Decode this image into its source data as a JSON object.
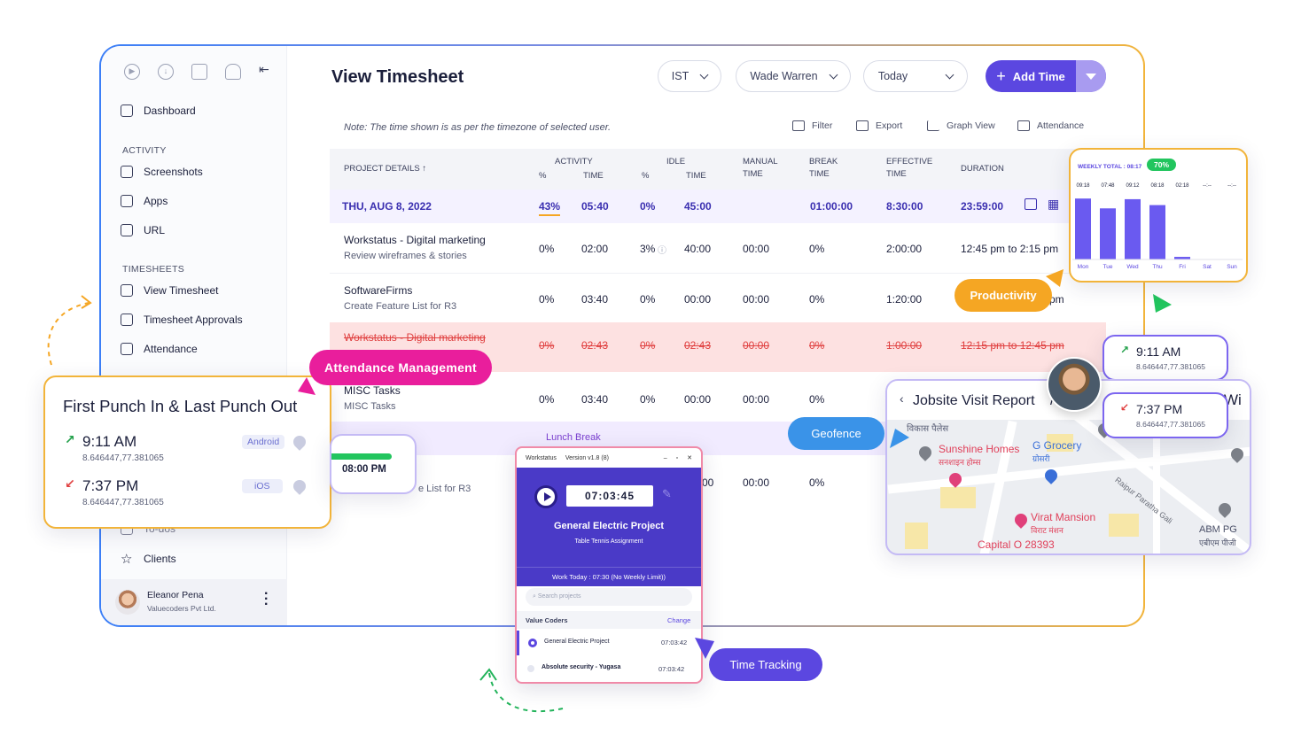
{
  "sidebar": {
    "dashboard": "Dashboard",
    "activity_heading": "ACTIVITY",
    "activity_items": [
      "Screenshots",
      "Apps",
      "URL"
    ],
    "timesheets_heading": "TIMESHEETS",
    "timesheet_items": [
      "View Timesheet",
      "Timesheet Approvals",
      "Attendance"
    ],
    "partial_item": "To-dos",
    "clients": "Clients",
    "user_name": "Eleanor Pena",
    "user_company": "Valuecoders Pvt Ltd."
  },
  "header": {
    "title": "View Timesheet",
    "timezone": "IST",
    "user_select": "Wade Warren",
    "date_select": "Today",
    "add_time": "Add Time"
  },
  "toolbar": {
    "note": "Note: The time shown is as per the timezone of selected user.",
    "filter": "Filter",
    "export": "Export",
    "graph_view": "Graph View",
    "attendance": "Attendance"
  },
  "table": {
    "headers": {
      "project": "PROJECT DETAILS ↑",
      "activity": "ACTIVITY",
      "activity_pct": "%",
      "activity_time": "TIME",
      "idle": "IDLE",
      "idle_pct": "%",
      "idle_time": "TIME",
      "manual": "MANUAL",
      "manual2": "TIME",
      "break": "BREAK",
      "break2": "TIME",
      "effective": "EFFECTIVE",
      "effective2": "TIME",
      "duration": "DURATION"
    },
    "date_row": {
      "date": "THU, AUG 8, 2022",
      "activity_pct": "43%",
      "activity_time": "05:40",
      "idle_pct": "0%",
      "idle_time": "45:00",
      "break_time": "01:00:00",
      "effective": "8:30:00",
      "duration": "23:59:00"
    },
    "rows": [
      {
        "project": "Workstatus - Digital marketing",
        "task": "Review wireframes & stories",
        "a_pct": "0%",
        "a_time": "02:00",
        "i_pct": "3%",
        "i_time": "40:00",
        "manual": "00:00",
        "brk": "0%",
        "effective": "2:00:00",
        "duration": "12:45 pm to 2:15 pm"
      },
      {
        "project": "SoftwareFirms",
        "task": "Create Feature List for R3",
        "a_pct": "0%",
        "a_time": "03:40",
        "i_pct": "0%",
        "i_time": "00:00",
        "manual": "00:00",
        "brk": "0%",
        "effective": "1:20:00",
        "duration": "pm"
      },
      {
        "project": "Workstatus - Digital marketing",
        "task": "",
        "a_pct": "0%",
        "a_time": "02:43",
        "i_pct": "0%",
        "i_time": "02:43",
        "manual": "00:00",
        "brk": "0%",
        "effective": "1:00:00",
        "duration": "12:15 pm to 12:45 pm"
      },
      {
        "project": "MISC Tasks",
        "task": "MISC Tasks",
        "a_pct": "0%",
        "a_time": "03:40",
        "i_pct": "0%",
        "i_time": "00:00",
        "manual": "00:00",
        "brk": "0%",
        "effective": "",
        "duration": ""
      }
    ],
    "lunch": "Lunch Break",
    "last_row": {
      "task": "e List for R3",
      "i_time": "00",
      "manual": "00:00",
      "brk": "0%"
    }
  },
  "tags": {
    "attendance": "Attendance Management",
    "productivity": "Productivity",
    "geofence": "Geofence",
    "time_tracking": "Time Tracking"
  },
  "punch_card": {
    "title": "First Punch In & Last Punch Out",
    "in_time": "9:11 AM",
    "in_coord": "8.646447,77.381065",
    "in_os": "Android",
    "out_time": "7:37 PM",
    "out_coord": "8.646447,77.381065",
    "out_os": "iOS"
  },
  "break_card": {
    "time": "08:00 PM"
  },
  "chart_card": {
    "label": "WEEKLY TOTAL : 08:17",
    "pct": "70%"
  },
  "chart_data": {
    "type": "bar",
    "categories": [
      "Mon",
      "Tue",
      "Wed",
      "Thu",
      "Fri",
      "Sat",
      "Sun"
    ],
    "values": [
      9.3,
      7.8,
      9.2,
      8.3,
      0.4,
      0,
      0
    ],
    "labels": [
      "09:18",
      "07:48",
      "09:12",
      "08:18",
      "02:18",
      "--:--",
      "--:--"
    ],
    "ylim": [
      0,
      10
    ],
    "color": "#6a5af0"
  },
  "geo": {
    "in_time": "9:11 AM",
    "in_coord": "8.646447,77.381065",
    "out_time": "7:37 PM",
    "out_coord": "8.646447,77.381065",
    "map_title": "Jobsite Visit Report",
    "map_title_tail": "/",
    "wi": "Wi",
    "places": [
      "Sunshine Homes",
      "सनशाइन होम्स",
      "G Grocery",
      "ग्रोसरी",
      "Virat Mansion",
      "विराट मंशन",
      "Capital O 28393",
      "ABM PG",
      "एबीएम पीजी",
      "Raipur Paratha Gali",
      "विकास पैलेस"
    ]
  },
  "app": {
    "name": "Workstatus",
    "version": "Version v1.8 (8)",
    "timer": "07:03:45",
    "project": "General Electric Project",
    "task": "Table Tennis Assignment",
    "work_today": "Work Today : 07:30 (No Weekly Limit))",
    "search_placeholder": "Search projects",
    "org": "Value Coders",
    "change": "Change",
    "projects": [
      {
        "name": "General Electric Project",
        "time": "07:03:42"
      },
      {
        "name": "Absolute security - Yugasa",
        "time": "07:03:42"
      }
    ]
  },
  "colors": {
    "brand": "#5b47e0",
    "pink": "#e91e9c",
    "orange": "#f5a623",
    "blue": "#3a93e8",
    "green": "#22c55e"
  }
}
